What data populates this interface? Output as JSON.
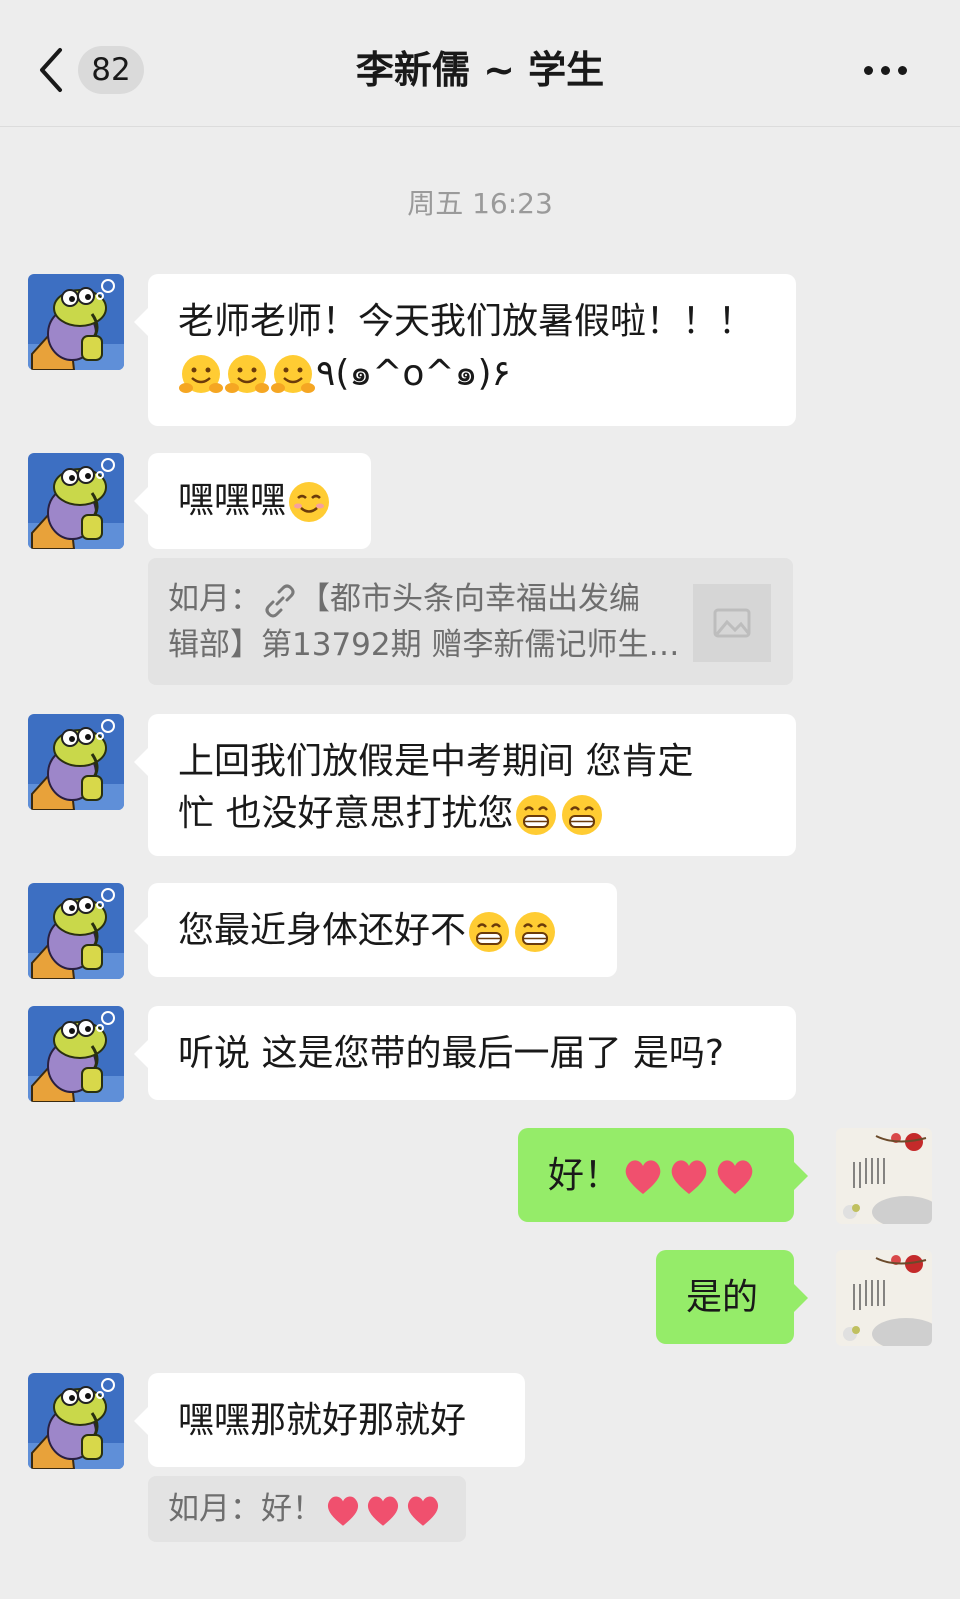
{
  "header": {
    "unread_count": "82",
    "title": "李新儒 ~ 学生"
  },
  "timestamp": "周五 16:23",
  "messages": {
    "m1": {
      "line1": "老师老师！今天我们放暑假啦！！！",
      "line2_tail": "٩(๑^o^๑)۶"
    },
    "m2": {
      "text": "嘿嘿嘿"
    },
    "q1": {
      "prefix": "如月：",
      "line1": "【都市头条向幸福出发编",
      "line2": "辑部】第13792期 赠李新儒记师生…"
    },
    "m3": {
      "line1": "上回我们放假是中考期间 您肯定",
      "line2": "忙 也没好意思打扰您"
    },
    "m4": {
      "text": "您最近身体还好不"
    },
    "m5": {
      "text": "听说 这是您带的最后一届了 是吗?"
    },
    "r1": {
      "text": "好！"
    },
    "r2": {
      "text": "是的"
    },
    "m6": {
      "text": "嘿嘿那就好那就好"
    },
    "q2": {
      "text": "如月：好！"
    }
  },
  "icons": {
    "back": "chevron-left-icon",
    "more": "more-dots-icon",
    "link": "link-icon"
  },
  "colors": {
    "background": "#ededed",
    "bubble_in": "#ffffff",
    "bubble_out": "#95ec69",
    "quote_bg": "#e3e3e3"
  }
}
